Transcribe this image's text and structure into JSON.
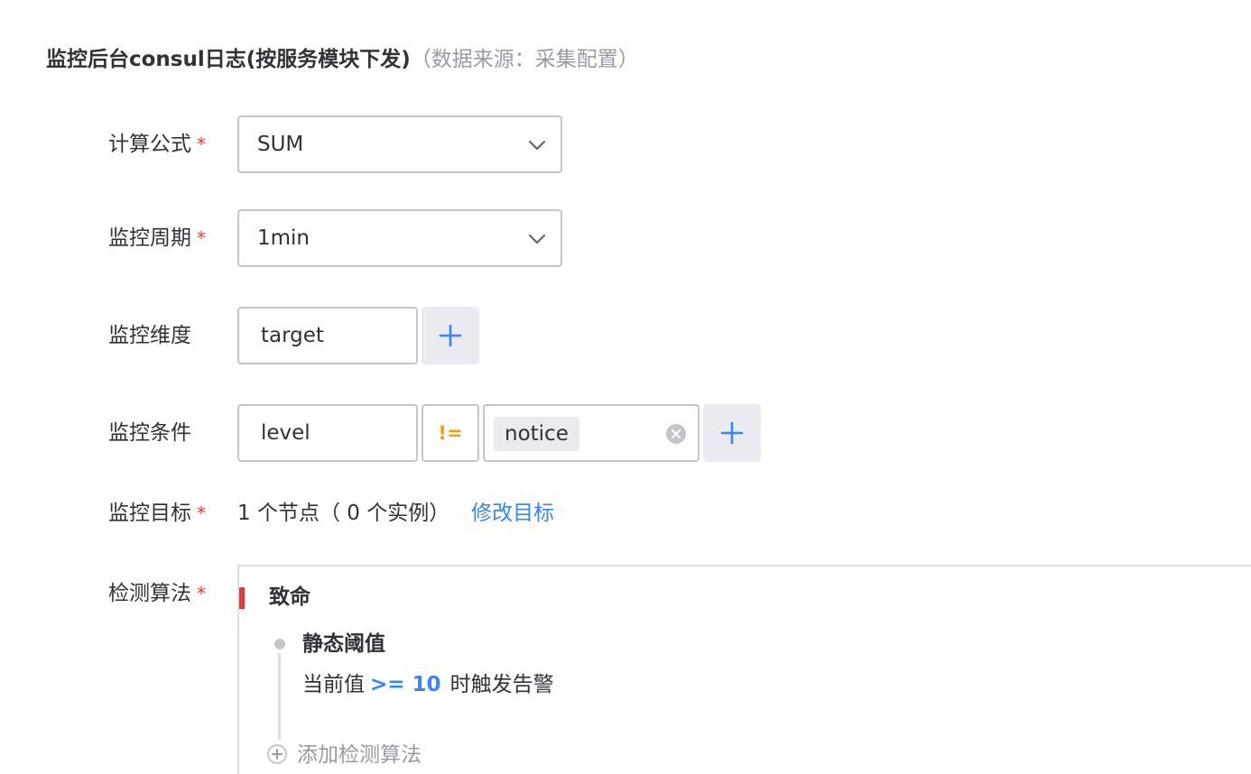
{
  "section": {
    "title": "监控后台consul日志(按服务模块下发)",
    "source": "（数据来源：采集配置）"
  },
  "form": {
    "formula": {
      "label": "计算公式",
      "required_mark": "*",
      "value": "SUM"
    },
    "period": {
      "label": "监控周期",
      "required_mark": "*",
      "value": "1min"
    },
    "dimension": {
      "label": "监控维度",
      "value": "target"
    },
    "condition": {
      "label": "监控条件",
      "key": "level",
      "operator": "!=",
      "value_tag": "notice"
    },
    "target": {
      "label": "监控目标",
      "required_mark": "*",
      "summary": "1 个节点（ 0 个实例）",
      "edit_link": "修改目标"
    },
    "algorithm": {
      "label": "检测算法",
      "required_mark": "*",
      "level": "致命",
      "level_color": "#ea3636",
      "items": [
        {
          "name": "静态阈值",
          "desc_prefix": "当前值",
          "threshold": ">= 10",
          "desc_suffix": "时触发告警"
        }
      ],
      "add_label": "添加检测算法"
    }
  },
  "colors": {
    "accent": "#3a84ff",
    "operator": "#ff9c01",
    "required": "#ea3636",
    "muted": "#979ba5"
  },
  "icons": [
    "chevron-down-icon",
    "plus-icon",
    "clear-icon",
    "add-circle-icon"
  ]
}
